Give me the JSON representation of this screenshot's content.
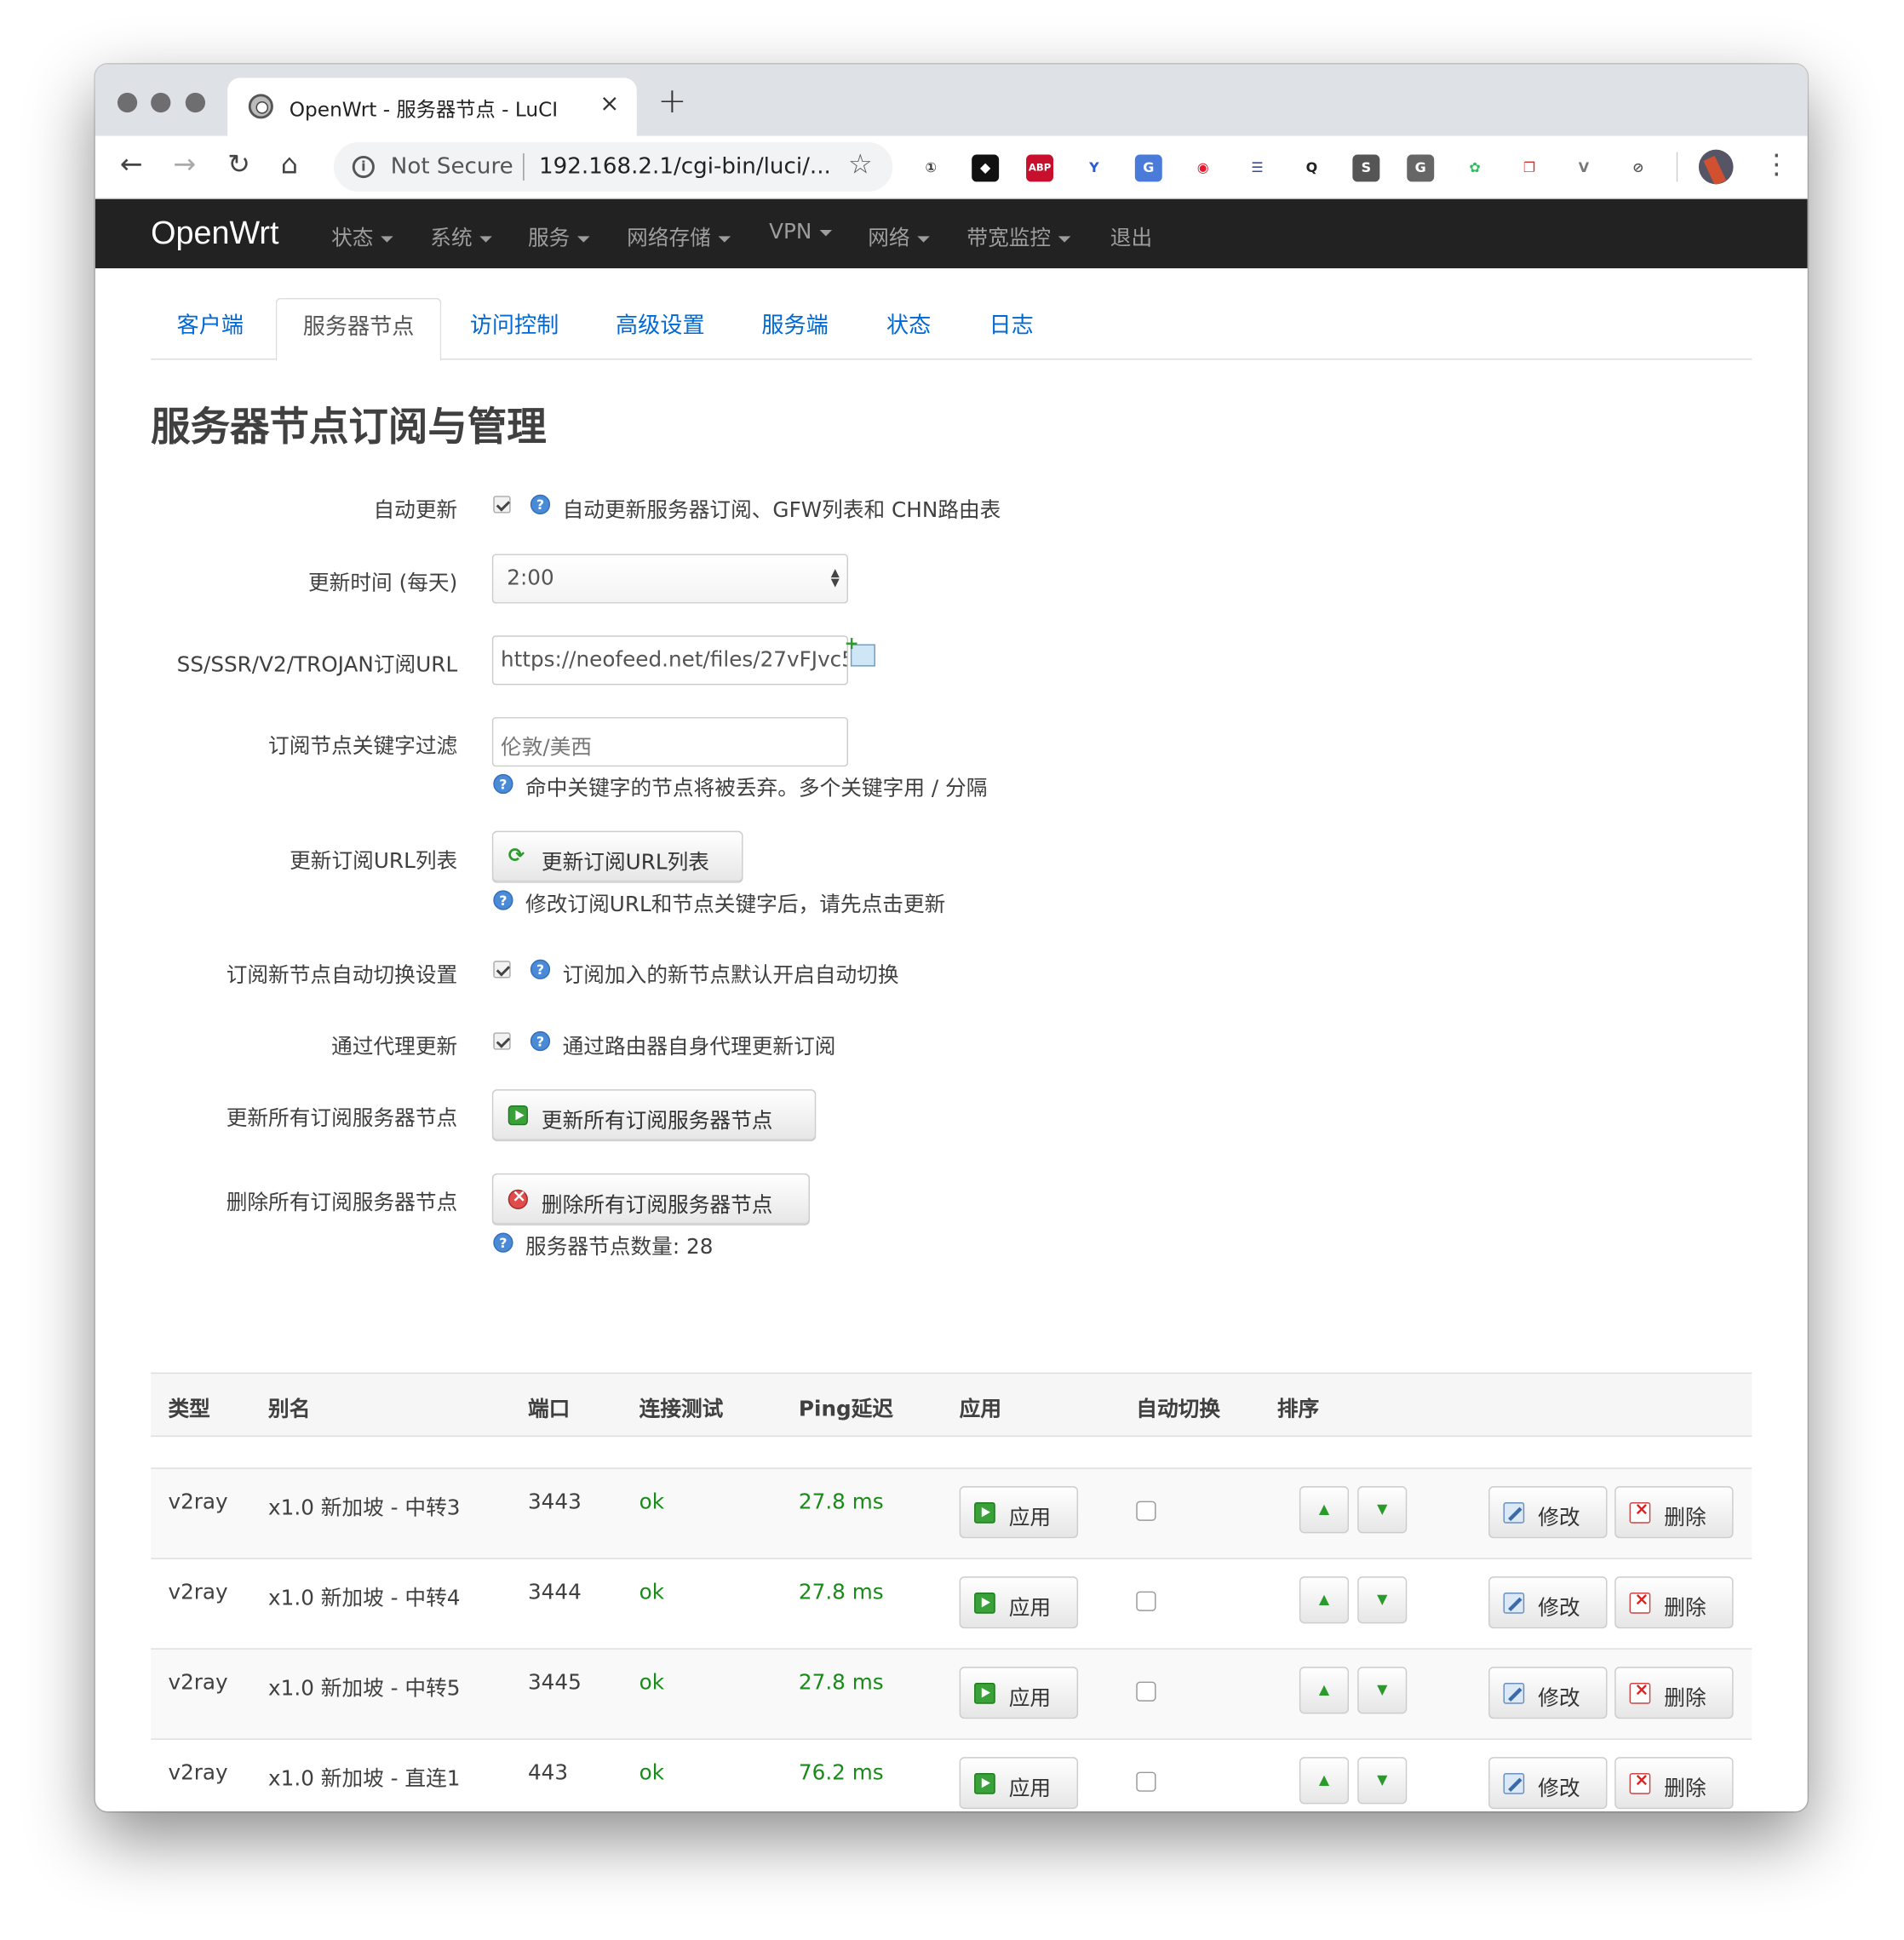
{
  "browser": {
    "tab_title": "OpenWrt - 服务器节点 - LuCI",
    "tab_close": "×",
    "new_tab": "+",
    "security_label": "Not Secure",
    "url": "192.168.2.1/cgi-bin/luci/...",
    "nav_back": "←",
    "nav_forward": "→",
    "nav_reload": "↻",
    "nav_home": "⌂",
    "bookmark_star": "☆",
    "menu_dots": "⋮",
    "extensions": [
      {
        "name": "1password-icon",
        "label": "①",
        "color": "#ffffff",
        "fg": "#333333"
      },
      {
        "name": "dropbox-icon",
        "label": "◆",
        "color": "#111111",
        "fg": "#ffffff"
      },
      {
        "name": "adblock-icon",
        "label": "ABP",
        "color": "#c8102e",
        "fg": "#ffffff"
      },
      {
        "name": "y-icon",
        "label": "Y",
        "color": "#ffffff",
        "fg": "#2a5ad0"
      },
      {
        "name": "translate-icon",
        "label": "G",
        "color": "#4a7bd8",
        "fg": "#ffffff"
      },
      {
        "name": "weibo-icon",
        "label": "◉",
        "color": "#ffffff",
        "fg": "#e6162d"
      },
      {
        "name": "reader-icon",
        "label": "☰",
        "color": "#ffffff",
        "fg": "#3a4a9a"
      },
      {
        "name": "q-icon",
        "label": "Q",
        "color": "#ffffff",
        "fg": "#222222"
      },
      {
        "name": "s-icon",
        "label": "S",
        "color": "#555555",
        "fg": "#ffffff"
      },
      {
        "name": "g-icon",
        "label": "G",
        "color": "#666666",
        "fg": "#ffffff"
      },
      {
        "name": "evernote-icon",
        "label": "✿",
        "color": "#ffffff",
        "fg": "#2dbe60"
      },
      {
        "name": "copy-icon",
        "label": "❐",
        "color": "#ffffff",
        "fg": "#d03030"
      },
      {
        "name": "vue-icon",
        "label": "V",
        "color": "#ffffff",
        "fg": "#777777"
      },
      {
        "name": "block-icon",
        "label": "⊘",
        "color": "#ffffff",
        "fg": "#555555"
      }
    ]
  },
  "app": {
    "brand": "OpenWrt",
    "menu": [
      "状态",
      "系统",
      "服务",
      "网络存储",
      "VPN",
      "网络",
      "带宽监控",
      "退出"
    ],
    "tabs": [
      "客户端",
      "服务器节点",
      "访问控制",
      "高级设置",
      "服务端",
      "状态",
      "日志"
    ],
    "active_tab": "服务器节点"
  },
  "section": {
    "title": "服务器节点订阅与管理",
    "auto_update": {
      "label": "自动更新",
      "checked": true,
      "help": "自动更新服务器订阅、GFW列表和 CHN路由表"
    },
    "update_time": {
      "label": "更新时间 (每天)",
      "value": "2:00"
    },
    "subscribe_url": {
      "label": "SS/SSR/V2/TROJAN订阅URL",
      "value": "https://neofeed.net/files/27vFJvc5"
    },
    "keyword_filter": {
      "label": "订阅节点关键字过滤",
      "placeholder": "伦敦/美西",
      "help": "命中关键字的节点将被丢弃。多个关键字用 / 分隔"
    },
    "update_url_list": {
      "label": "更新订阅URL列表",
      "button": "更新订阅URL列表",
      "help": "修改订阅URL和节点关键字后，请先点击更新"
    },
    "auto_switch": {
      "label": "订阅新节点自动切换设置",
      "checked": true,
      "help": "订阅加入的新节点默认开启自动切换"
    },
    "proxy_update": {
      "label": "通过代理更新",
      "checked": true,
      "help": "通过路由器自身代理更新订阅"
    },
    "update_all": {
      "label": "更新所有订阅服务器节点",
      "button": "更新所有订阅服务器节点"
    },
    "delete_all": {
      "label": "删除所有订阅服务器节点",
      "button": "删除所有订阅服务器节点",
      "help": "服务器节点数量: 28"
    },
    "help_icon": "?"
  },
  "table": {
    "headers": [
      "类型",
      "别名",
      "端口",
      "连接测试",
      "Ping延迟",
      "应用",
      "自动切换",
      "排序"
    ],
    "apply_label": "应用",
    "edit_label": "修改",
    "delete_label": "删除",
    "up_arrow": "▲",
    "down_arrow": "▼",
    "rows": [
      {
        "type": "v2ray",
        "alias": "x1.0 新加坡 - 中转3",
        "port": "3443",
        "test": "ok",
        "ping": "27.8 ms",
        "auto_switch": false
      },
      {
        "type": "v2ray",
        "alias": "x1.0 新加坡 - 中转4",
        "port": "3444",
        "test": "ok",
        "ping": "27.8 ms",
        "auto_switch": false
      },
      {
        "type": "v2ray",
        "alias": "x1.0 新加坡 - 中转5",
        "port": "3445",
        "test": "ok",
        "ping": "27.8 ms",
        "auto_switch": false
      },
      {
        "type": "v2ray",
        "alias": "x1.0 新加坡 - 直连1",
        "port": "443",
        "test": "ok",
        "ping": "76.2 ms",
        "auto_switch": false
      }
    ]
  }
}
